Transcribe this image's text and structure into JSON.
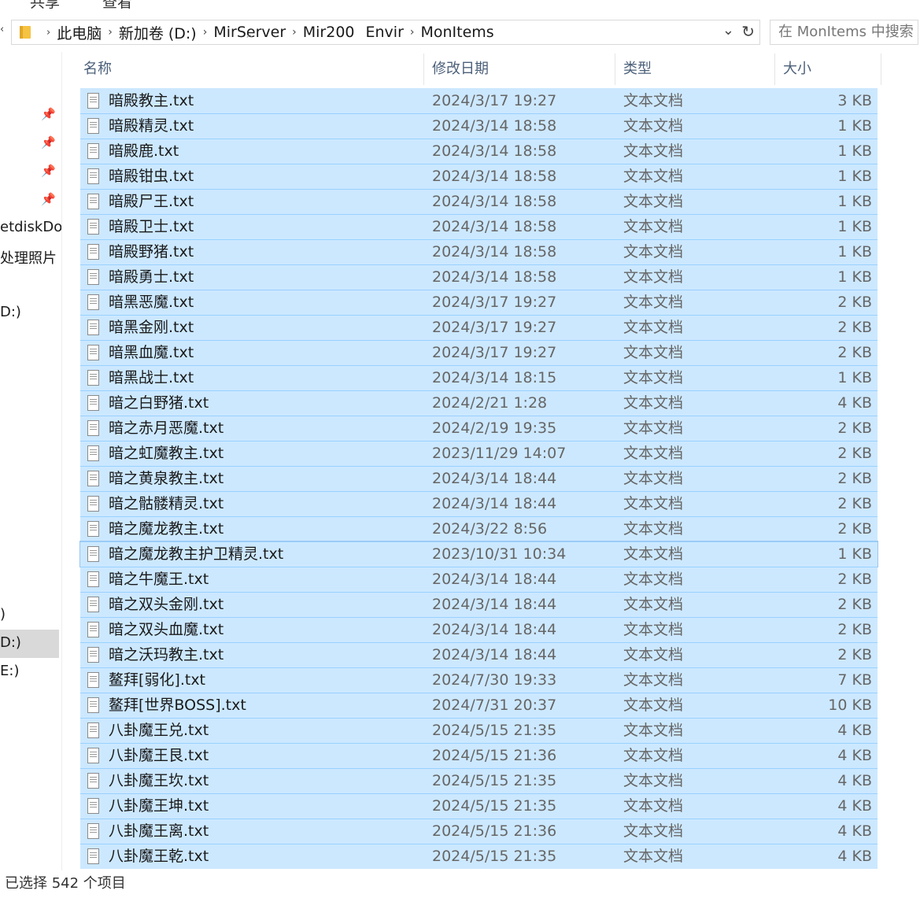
{
  "ribbon": {
    "share": "共享",
    "view": "查看"
  },
  "address": {
    "crumbs": [
      "此电脑",
      "新加卷 (D:)",
      "MirServer",
      "Mir200",
      "Envir",
      "MonItems"
    ],
    "search_placeholder": "在 MonItems 中搜索"
  },
  "nav": {
    "labels": [
      "etdiskDo",
      "处理照片",
      "D:)",
      ")",
      "D:)",
      "E:)"
    ]
  },
  "columns": {
    "name": "名称",
    "date": "修改日期",
    "type": "类型",
    "size": "大小"
  },
  "files": [
    {
      "name": "暗殿教主.txt",
      "date": "2024/3/17 19:27",
      "type": "文本文档",
      "size": "3 KB"
    },
    {
      "name": "暗殿精灵.txt",
      "date": "2024/3/14 18:58",
      "type": "文本文档",
      "size": "1 KB"
    },
    {
      "name": "暗殿鹿.txt",
      "date": "2024/3/14 18:58",
      "type": "文本文档",
      "size": "1 KB"
    },
    {
      "name": "暗殿钳虫.txt",
      "date": "2024/3/14 18:58",
      "type": "文本文档",
      "size": "1 KB"
    },
    {
      "name": "暗殿尸王.txt",
      "date": "2024/3/14 18:58",
      "type": "文本文档",
      "size": "1 KB"
    },
    {
      "name": "暗殿卫士.txt",
      "date": "2024/3/14 18:58",
      "type": "文本文档",
      "size": "1 KB"
    },
    {
      "name": "暗殿野猪.txt",
      "date": "2024/3/14 18:58",
      "type": "文本文档",
      "size": "1 KB"
    },
    {
      "name": "暗殿勇士.txt",
      "date": "2024/3/14 18:58",
      "type": "文本文档",
      "size": "1 KB"
    },
    {
      "name": "暗黑恶魔.txt",
      "date": "2024/3/17 19:27",
      "type": "文本文档",
      "size": "2 KB"
    },
    {
      "name": "暗黑金刚.txt",
      "date": "2024/3/17 19:27",
      "type": "文本文档",
      "size": "2 KB"
    },
    {
      "name": "暗黑血魔.txt",
      "date": "2024/3/17 19:27",
      "type": "文本文档",
      "size": "2 KB"
    },
    {
      "name": "暗黑战士.txt",
      "date": "2024/3/14 18:15",
      "type": "文本文档",
      "size": "1 KB"
    },
    {
      "name": "暗之白野猪.txt",
      "date": "2024/2/21 1:28",
      "type": "文本文档",
      "size": "4 KB"
    },
    {
      "name": "暗之赤月恶魔.txt",
      "date": "2024/2/19 19:35",
      "type": "文本文档",
      "size": "2 KB"
    },
    {
      "name": "暗之虹魔教主.txt",
      "date": "2023/11/29 14:07",
      "type": "文本文档",
      "size": "2 KB"
    },
    {
      "name": "暗之黄泉教主.txt",
      "date": "2024/3/14 18:44",
      "type": "文本文档",
      "size": "2 KB"
    },
    {
      "name": "暗之骷髅精灵.txt",
      "date": "2024/3/14 18:44",
      "type": "文本文档",
      "size": "2 KB"
    },
    {
      "name": "暗之魔龙教主.txt",
      "date": "2024/3/22 8:56",
      "type": "文本文档",
      "size": "2 KB"
    },
    {
      "name": "暗之魔龙教主护卫精灵.txt",
      "date": "2023/10/31 10:34",
      "type": "文本文档",
      "size": "1 KB"
    },
    {
      "name": "暗之牛魔王.txt",
      "date": "2024/3/14 18:44",
      "type": "文本文档",
      "size": "2 KB"
    },
    {
      "name": "暗之双头金刚.txt",
      "date": "2024/3/14 18:44",
      "type": "文本文档",
      "size": "2 KB"
    },
    {
      "name": "暗之双头血魔.txt",
      "date": "2024/3/14 18:44",
      "type": "文本文档",
      "size": "2 KB"
    },
    {
      "name": "暗之沃玛教主.txt",
      "date": "2024/3/14 18:44",
      "type": "文本文档",
      "size": "2 KB"
    },
    {
      "name": "鳌拜[弱化].txt",
      "date": "2024/7/30 19:33",
      "type": "文本文档",
      "size": "7 KB"
    },
    {
      "name": "鳌拜[世界BOSS].txt",
      "date": "2024/7/31 20:37",
      "type": "文本文档",
      "size": "10 KB"
    },
    {
      "name": "八卦魔王兑.txt",
      "date": "2024/5/15 21:35",
      "type": "文本文档",
      "size": "4 KB"
    },
    {
      "name": "八卦魔王艮.txt",
      "date": "2024/5/15 21:36",
      "type": "文本文档",
      "size": "4 KB"
    },
    {
      "name": "八卦魔王坎.txt",
      "date": "2024/5/15 21:35",
      "type": "文本文档",
      "size": "4 KB"
    },
    {
      "name": "八卦魔王坤.txt",
      "date": "2024/5/15 21:35",
      "type": "文本文档",
      "size": "4 KB"
    },
    {
      "name": "八卦魔王离.txt",
      "date": "2024/5/15 21:36",
      "type": "文本文档",
      "size": "4 KB"
    },
    {
      "name": "八卦魔王乾.txt",
      "date": "2024/5/15 21:35",
      "type": "文本文档",
      "size": "4 KB"
    }
  ],
  "status": "已选择 542 个项目"
}
